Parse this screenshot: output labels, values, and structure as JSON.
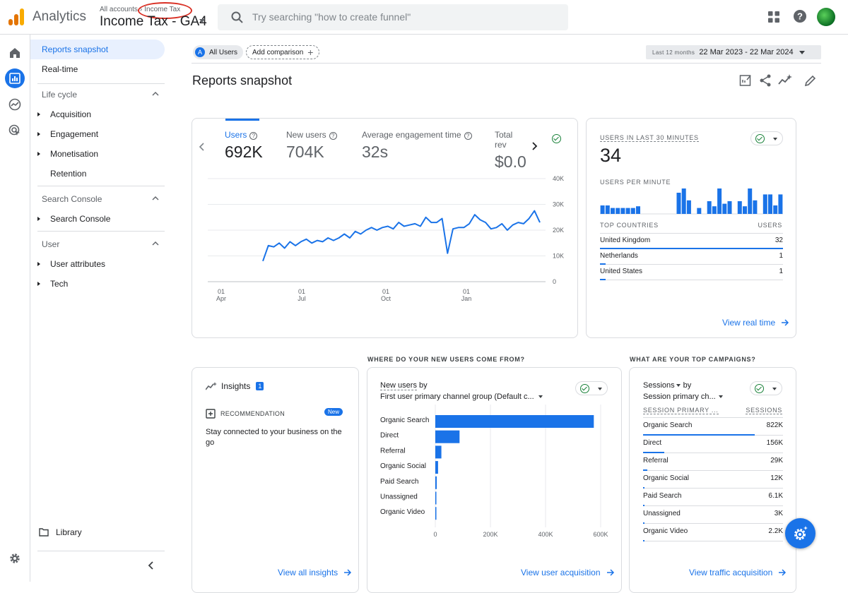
{
  "app": {
    "name": "Analytics"
  },
  "account": {
    "all_accounts": "All accounts",
    "account_name": "Income Tax",
    "property_name": "Income Tax - GA4"
  },
  "search": {
    "placeholder": "Try searching \"how to create funnel\""
  },
  "sidemenu": {
    "snapshot": "Reports snapshot",
    "realtime": "Real-time",
    "sections": [
      {
        "label": "Life cycle",
        "items": [
          "Acquisition",
          "Engagement",
          "Monetisation",
          "Retention"
        ]
      },
      {
        "label": "Search Console",
        "items": [
          "Search Console"
        ]
      },
      {
        "label": "User",
        "items": [
          "User attributes",
          "Tech"
        ]
      }
    ],
    "library": "Library"
  },
  "comparison": {
    "segment_letter": "A",
    "segment": "All Users",
    "add_comparison": "Add comparison"
  },
  "date_range": {
    "label": "Last 12 months",
    "value": "22 Mar 2023 - 22 Mar 2024"
  },
  "page": {
    "title": "Reports snapshot"
  },
  "overview": {
    "metrics": [
      {
        "label": "Users",
        "value": "692K"
      },
      {
        "label": "New users",
        "value": "704K"
      },
      {
        "label": "Average engagement time",
        "value": "32s"
      },
      {
        "label": "Total rev",
        "value": "$0.0"
      }
    ]
  },
  "realtime_card": {
    "title": "USERS IN LAST 30 MINUTES",
    "value": "34",
    "per_minute_label": "USERS PER MINUTE",
    "countries_header": "TOP COUNTRIES",
    "users_header": "USERS",
    "countries": [
      {
        "name": "United Kingdom",
        "value": "32",
        "share": 1.0
      },
      {
        "name": "Netherlands",
        "value": "1",
        "share": 0.03
      },
      {
        "name": "United States",
        "value": "1",
        "share": 0.03
      }
    ],
    "link": "View real time",
    "per_minute_values": [
      1,
      1,
      0.7,
      0.7,
      0.7,
      0.7,
      0.7,
      0.9,
      0,
      0,
      0,
      0,
      0,
      0,
      0,
      2.5,
      3,
      1.6,
      0,
      0.7,
      0,
      1.5,
      0.9,
      3,
      1.2,
      1.5,
      0,
      1.5,
      0.9,
      3,
      1.6,
      0,
      2.3,
      2.3,
      1,
      2.3
    ]
  },
  "insights_card": {
    "title": "Insights",
    "badge": "1",
    "recommendation_label": "RECOMMENDATION",
    "new_badge": "New",
    "recommendation_text": "Stay connected to your business on the go",
    "link": "View all insights"
  },
  "acquisition_section": {
    "heading": "WHERE DO YOUR NEW USERS COME FROM?",
    "metric": "New users",
    "by": "by",
    "dimension": "First user primary channel group (Default c...",
    "link": "View user acquisition"
  },
  "campaigns_section": {
    "heading": "WHAT ARE YOUR TOP CAMPAIGNS?",
    "metric": "Sessions",
    "by": "by",
    "dimension": "Session primary ch...",
    "col_dimension": "SESSION PRIMARY ...",
    "col_metric": "SESSIONS",
    "rows": [
      {
        "name": "Organic Search",
        "value": "822K",
        "share": 1.0
      },
      {
        "name": "Direct",
        "value": "156K",
        "share": 0.19
      },
      {
        "name": "Referral",
        "value": "29K",
        "share": 0.035
      },
      {
        "name": "Organic Social",
        "value": "12K",
        "share": 0.015
      },
      {
        "name": "Paid Search",
        "value": "6.1K",
        "share": 0.008
      },
      {
        "name": "Unassigned",
        "value": "3K",
        "share": 0.004
      },
      {
        "name": "Organic Video",
        "value": "2.2K",
        "share": 0.003
      }
    ],
    "link": "View traffic acquisition"
  },
  "chart_data": [
    {
      "type": "line",
      "x_tick_labels": [
        "01 Apr",
        "01 Jul",
        "01 Oct",
        "01 Jan"
      ],
      "y_tick_labels": [
        "40K",
        "30K",
        "20K",
        "10K",
        "0"
      ],
      "ylim": [
        0,
        40000
      ],
      "series": [
        {
          "name": "Users",
          "values": [
            8000,
            14000,
            13500,
            15000,
            13000,
            15500,
            14000,
            15500,
            16500,
            15000,
            16000,
            15500,
            17000,
            16000,
            17000,
            18500,
            17000,
            19500,
            18500,
            20000,
            21000,
            20000,
            21000,
            21500,
            20500,
            23000,
            21500,
            22000,
            22500,
            21500,
            25000,
            23000,
            23000,
            24500,
            11000,
            20500,
            21000,
            21000,
            22500,
            26000,
            24000,
            23000,
            20500,
            21000,
            22500,
            20000,
            22000,
            23000,
            22500,
            24500,
            27500,
            23000
          ]
        }
      ]
    },
    {
      "type": "bar",
      "orientation": "horizontal",
      "categories": [
        "Organic Search",
        "Direct",
        "Referral",
        "Organic Social",
        "Paid Search",
        "Unassigned",
        "Organic Video"
      ],
      "series": [
        {
          "name": "New users",
          "values": [
            575000,
            88000,
            22000,
            10000,
            5000,
            2500,
            1800
          ]
        }
      ],
      "x_tick_labels": [
        "0",
        "200K",
        "400K",
        "600K"
      ],
      "xlim": [
        0,
        600000
      ]
    }
  ],
  "colors": {
    "accent": "#1a73e8",
    "success": "#188038",
    "alert": "#d93025"
  }
}
